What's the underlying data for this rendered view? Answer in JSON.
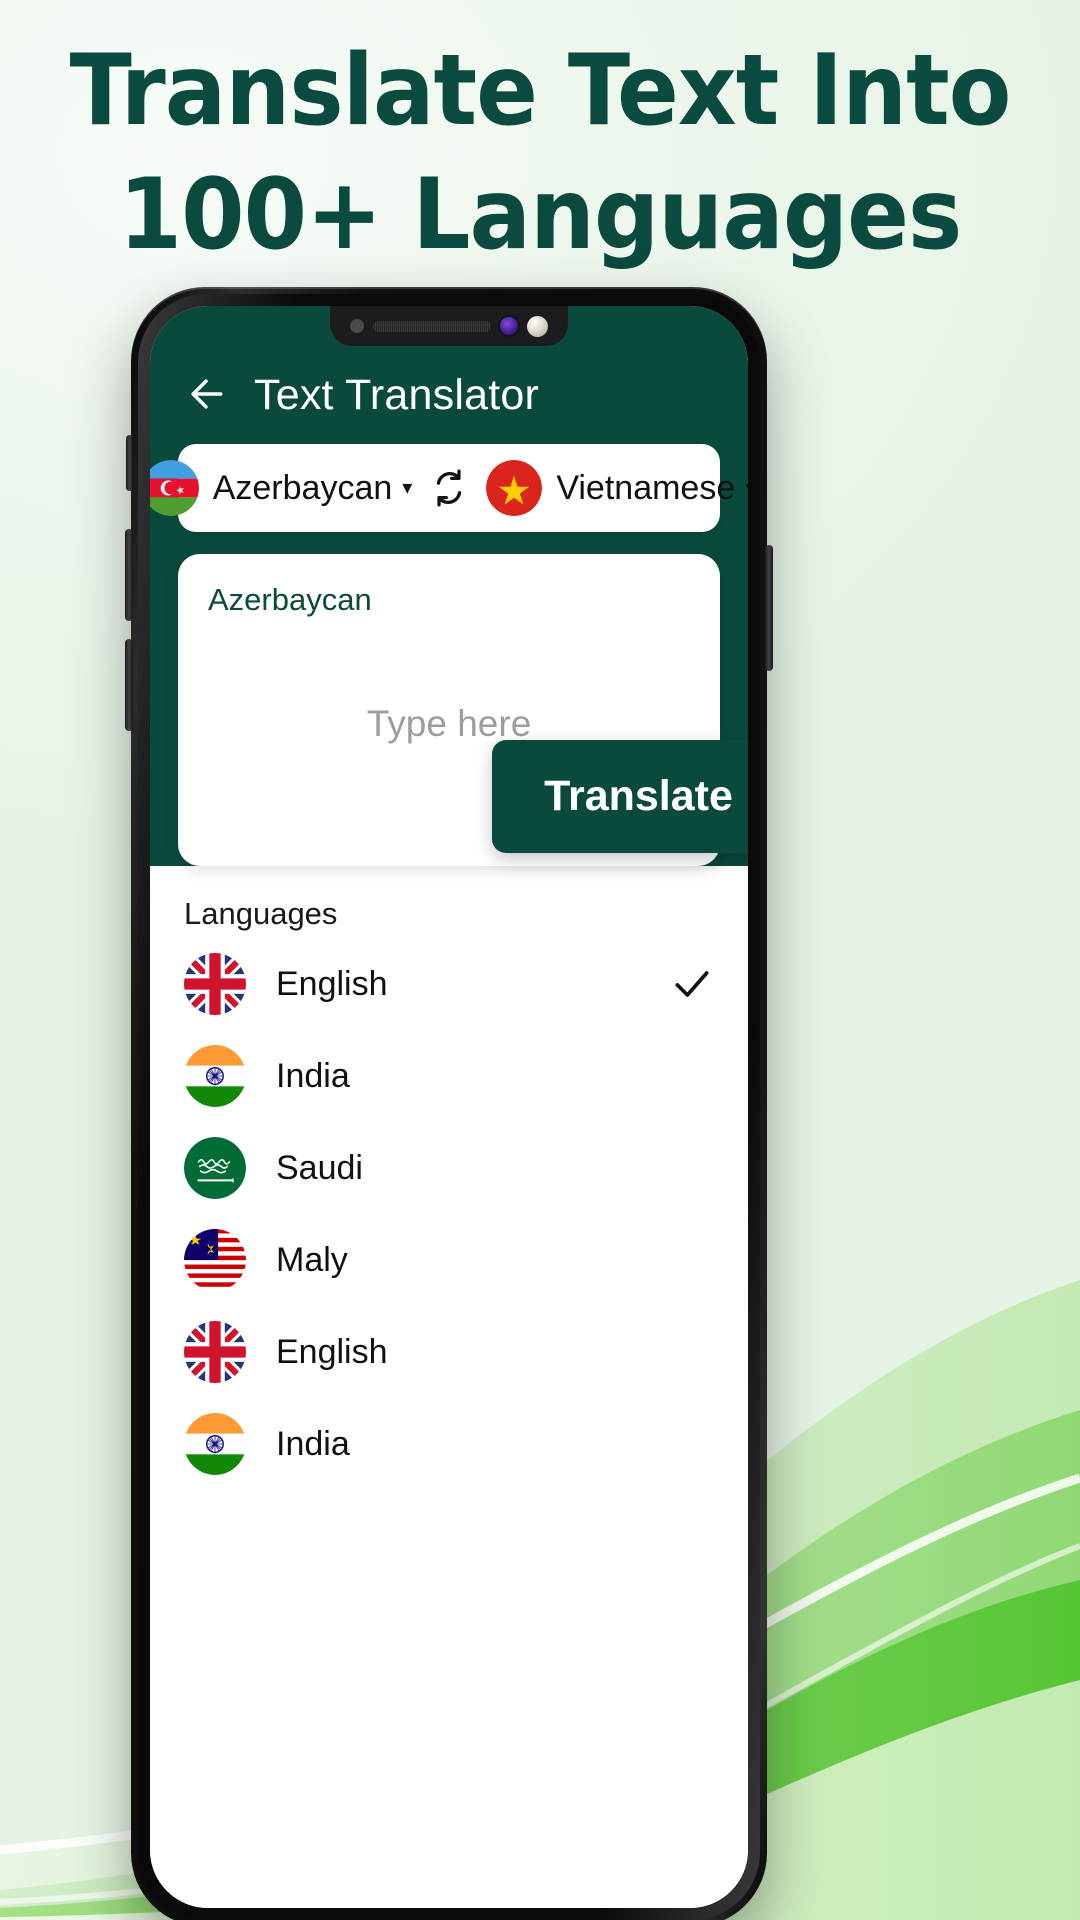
{
  "promo": {
    "headline_line1": "Translate Text Into",
    "headline_line2": "100+ Languages",
    "headline_color": "#0b4a3f",
    "background_color": "#eef7ee"
  },
  "app": {
    "brand_color": "#0a4a3d",
    "appbar": {
      "back_icon": "arrow-left-icon",
      "title": "Text Translator"
    },
    "language_selector": {
      "source": {
        "flag": "azerbaijan-flag",
        "name": "Azerbaycan",
        "caret": "▾"
      },
      "swap_icon": "swap-arrows-icon",
      "target": {
        "flag": "vietnam-flag",
        "name": "Vietnamese",
        "caret": "▾"
      }
    },
    "input_card": {
      "source_label": "Azerbaycan",
      "placeholder": "Type here",
      "value": ""
    },
    "translate_button": {
      "label": "Translate"
    },
    "languages_section": {
      "title": "Languages",
      "items": [
        {
          "label": "English",
          "flag": "uk-flag",
          "selected": true
        },
        {
          "label": "India",
          "flag": "india-flag",
          "selected": false
        },
        {
          "label": "Saudi",
          "flag": "saudi-flag",
          "selected": false
        },
        {
          "label": "Maly",
          "flag": "malaysia-flag",
          "selected": false
        },
        {
          "label": "English",
          "flag": "uk-flag",
          "selected": false
        },
        {
          "label": "India",
          "flag": "india-flag",
          "selected": false
        }
      ],
      "check_icon": "check-icon"
    }
  }
}
